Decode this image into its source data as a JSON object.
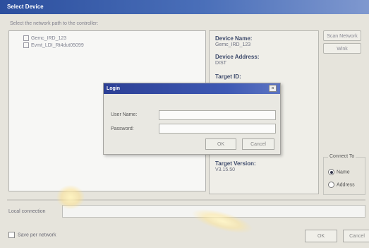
{
  "window": {
    "title": "Select Device"
  },
  "instruction": "Select the network path to the controller:",
  "tree": {
    "items": [
      {
        "label": "Gemc_IRD_123"
      },
      {
        "label": "Evmt_LDI_Rt4dut05099"
      }
    ]
  },
  "info": {
    "device_name_label": "Device Name:",
    "device_name_value": "Gemc_IRD_123",
    "device_address_label": "Device Address:",
    "device_address_value": "DIST",
    "target_id_label": "Target ID:",
    "target_version_label": "Target Version:",
    "target_version_value": "V3.15.50"
  },
  "side_buttons": {
    "scan_label": "Scan Network",
    "wink_label": "Wink"
  },
  "connect_group": {
    "legend": "Connect To",
    "options": [
      {
        "label": "Name",
        "selected": true
      },
      {
        "label": "Address",
        "selected": false
      }
    ]
  },
  "connection": {
    "label": "Local connection",
    "value": ""
  },
  "save_option": {
    "label": "Save per network",
    "checked": false
  },
  "buttons": {
    "ok": "OK",
    "cancel": "Cancel"
  },
  "login": {
    "title": "Login",
    "close_glyph": "×",
    "user_name_label": "User Name:",
    "user_name_value": "",
    "password_label": "Password:",
    "password_value": "",
    "ok_label": "OK",
    "cancel_label": "Cancel"
  },
  "colors": {
    "title_bar": "#2c4f9e",
    "dialog_title_bar": "#2c3f95",
    "panel": "#e6e4dc"
  }
}
